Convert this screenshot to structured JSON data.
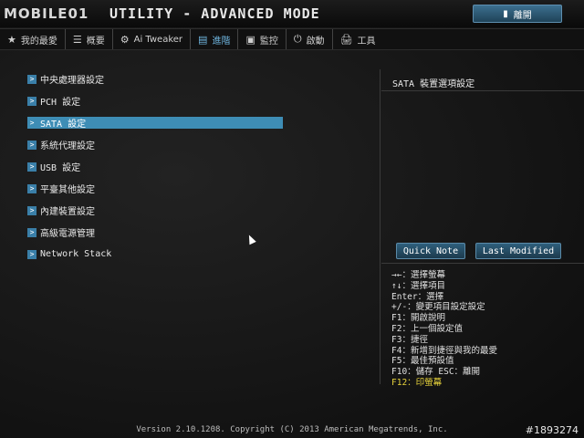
{
  "header": {
    "logo": "MOBILE01",
    "title": "UTILITY - ADVANCED MODE",
    "exit_label": "離開",
    "exit_icon": "exit-icon"
  },
  "nav": [
    {
      "icon": "★",
      "label": "我的最愛"
    },
    {
      "icon": "☰",
      "label": "概要"
    },
    {
      "icon": "⚙",
      "label": "Ai Tweaker"
    },
    {
      "icon": "▤",
      "label": "進階"
    },
    {
      "icon": "▣",
      "label": "監控"
    },
    {
      "icon": "⏻",
      "label": "啟動"
    },
    {
      "icon": "🖨",
      "label": "工具"
    }
  ],
  "menu": [
    {
      "label": "中央處理器設定"
    },
    {
      "label": "PCH 設定"
    },
    {
      "label": "SATA 設定"
    },
    {
      "label": "系統代理設定"
    },
    {
      "label": "USB 設定"
    },
    {
      "label": "平臺其他設定"
    },
    {
      "label": "內建裝置設定"
    },
    {
      "label": "高級電源管理"
    },
    {
      "label": "Network Stack"
    }
  ],
  "help": {
    "title": "SATA 裝置選項設定"
  },
  "buttons": {
    "quick_note": "Quick Note",
    "last_modified": "Last Modified"
  },
  "keys": [
    "→←：選擇螢幕",
    "↑↓：選擇項目",
    "Enter：選擇",
    "+/-：變更項目設定設定",
    "F1：開啟說明",
    "F2：上一個設定值",
    "F3：捷徑",
    "F4：新增到捷徑與我的最愛",
    "F5：最佳預設值",
    "F10：儲存  ESC：離開",
    "F12：印螢幕"
  ],
  "footer": {
    "version": "Version 2.10.1208. Copyright (C) 2013 American Megatrends, Inc.",
    "watermark": "#1893274"
  },
  "colors": {
    "accent": "#3e8db5",
    "highlight": "#e6d23c"
  }
}
